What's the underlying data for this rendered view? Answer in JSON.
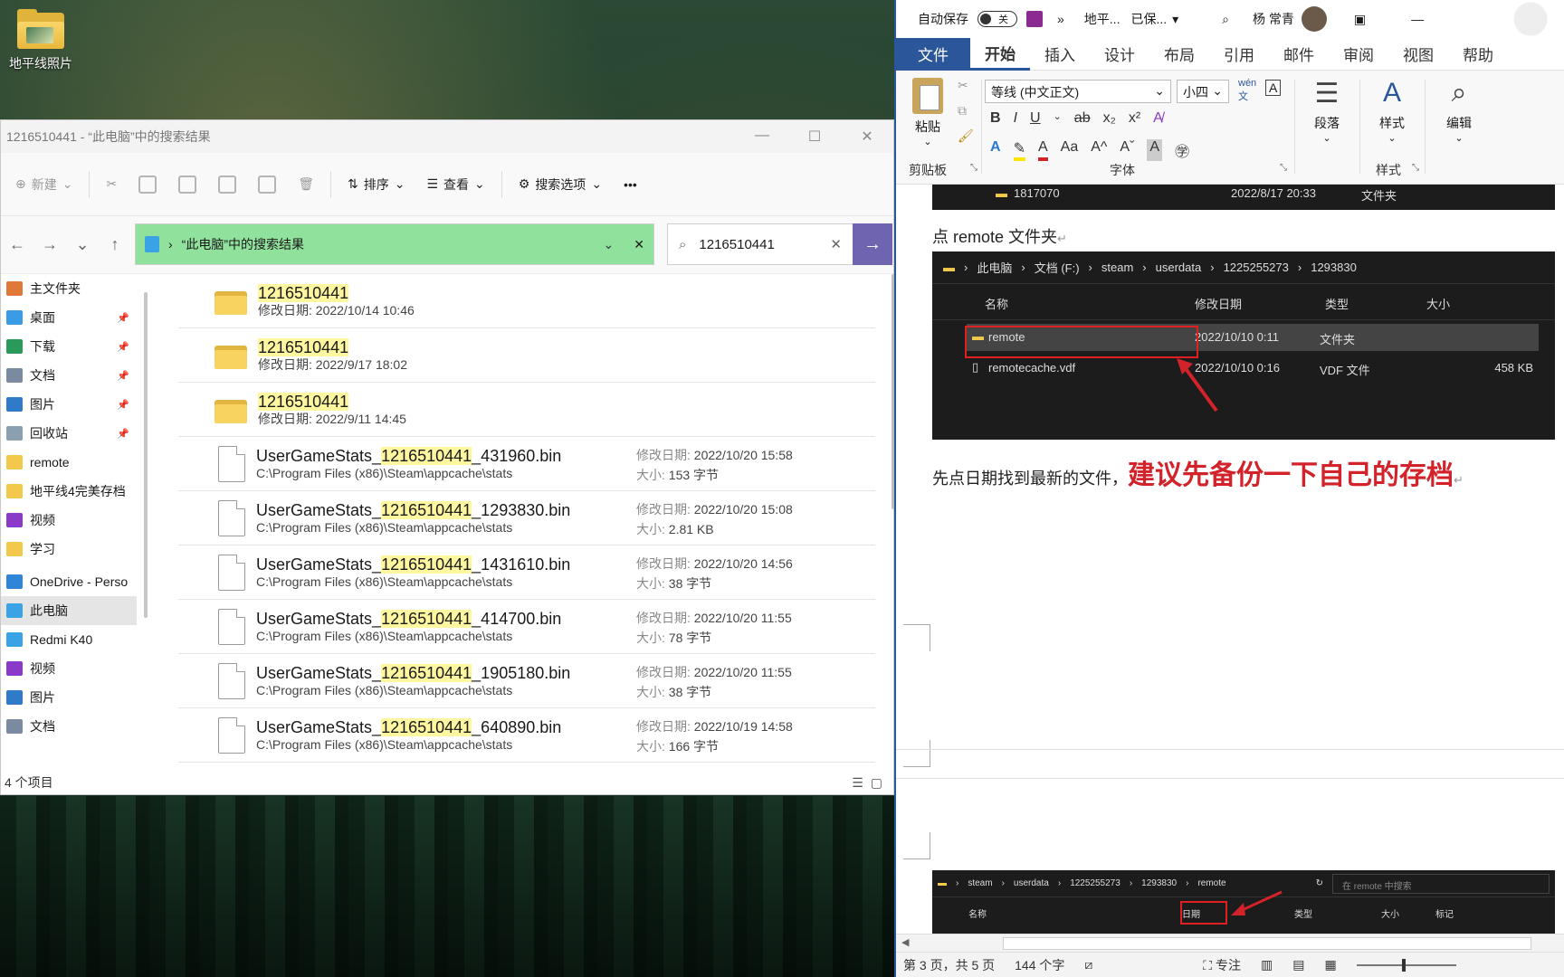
{
  "desktop": {
    "icon_label": "地平线照片"
  },
  "explorer": {
    "title": "1216510441 - “此电脑”中的搜索结果",
    "window_controls": [
      "—",
      "☐",
      "✕"
    ],
    "toolbar": {
      "new": "新建",
      "sort": "排序",
      "view": "查看",
      "search_options": "搜索选项",
      "more": "•••"
    },
    "address": "“此电脑”中的搜索结果",
    "search_value": "1216510441",
    "sidebar": [
      {
        "label": "主文件夹",
        "icon": "home-icon",
        "color": "#e0783a",
        "pinned": false
      },
      {
        "label": "桌面",
        "icon": "desktop-icon",
        "color": "#3a9be6",
        "pinned": true
      },
      {
        "label": "下载",
        "icon": "download-icon",
        "color": "#2a9a5a",
        "pinned": true
      },
      {
        "label": "文档",
        "icon": "document-icon",
        "color": "#7a8aa0",
        "pinned": true
      },
      {
        "label": "图片",
        "icon": "pictures-icon",
        "color": "#2f7ac9",
        "pinned": true
      },
      {
        "label": "回收站",
        "icon": "recycle-bin-icon",
        "color": "#8aa0b0",
        "pinned": true
      },
      {
        "label": "remote",
        "icon": "folder-icon",
        "color": "#f2c94c",
        "pinned": false
      },
      {
        "label": "地平线4完美存档",
        "icon": "folder-icon",
        "color": "#f2c94c",
        "pinned": false
      },
      {
        "label": "视频",
        "icon": "video-icon",
        "color": "#8a3ac9",
        "pinned": false
      },
      {
        "label": "学习",
        "icon": "folder-icon",
        "color": "#f2c94c",
        "pinned": false
      },
      {
        "label": "OneDrive - Perso",
        "icon": "onedrive-icon",
        "color": "#2f86d8",
        "pinned": false
      },
      {
        "label": "此电脑",
        "icon": "this-pc-icon",
        "color": "#3aa3e6",
        "pinned": false
      },
      {
        "label": "Redmi K40",
        "icon": "phone-icon",
        "color": "#3aa3e6",
        "pinned": false
      },
      {
        "label": "视频",
        "icon": "video-icon",
        "color": "#8a3ac9",
        "pinned": false
      },
      {
        "label": "图片",
        "icon": "pictures-icon",
        "color": "#2f7ac9",
        "pinned": false
      },
      {
        "label": "文档",
        "icon": "document-icon",
        "color": "#7a8aa0",
        "pinned": false
      }
    ],
    "folders": [
      {
        "name": "1216510441",
        "date_label": "修改日期:",
        "date": "2022/10/14 10:46"
      },
      {
        "name": "1216510441",
        "date_label": "修改日期:",
        "date": "2022/9/17 18:02"
      },
      {
        "name": "1216510441",
        "date_label": "修改日期:",
        "date": "2022/9/11 14:45"
      }
    ],
    "files": [
      {
        "prefix": "UserGameStats_",
        "match": "1216510441",
        "suffix": "_431960.bin",
        "path": "C:\\Program Files (x86)\\Steam\\appcache\\stats",
        "date_label": "修改日期:",
        "date": "2022/10/20 15:58",
        "size_label": "大小:",
        "size": "153 字节"
      },
      {
        "prefix": "UserGameStats_",
        "match": "1216510441",
        "suffix": "_1293830.bin",
        "path": "C:\\Program Files (x86)\\Steam\\appcache\\stats",
        "date_label": "修改日期:",
        "date": "2022/10/20 15:08",
        "size_label": "大小:",
        "size": "2.81 KB"
      },
      {
        "prefix": "UserGameStats_",
        "match": "1216510441",
        "suffix": "_1431610.bin",
        "path": "C:\\Program Files (x86)\\Steam\\appcache\\stats",
        "date_label": "修改日期:",
        "date": "2022/10/20 14:56",
        "size_label": "大小:",
        "size": "38 字节"
      },
      {
        "prefix": "UserGameStats_",
        "match": "1216510441",
        "suffix": "_414700.bin",
        "path": "C:\\Program Files (x86)\\Steam\\appcache\\stats",
        "date_label": "修改日期:",
        "date": "2022/10/20 11:55",
        "size_label": "大小:",
        "size": "78 字节"
      },
      {
        "prefix": "UserGameStats_",
        "match": "1216510441",
        "suffix": "_1905180.bin",
        "path": "C:\\Program Files (x86)\\Steam\\appcache\\stats",
        "date_label": "修改日期:",
        "date": "2022/10/20 11:55",
        "size_label": "大小:",
        "size": "38 字节"
      },
      {
        "prefix": "UserGameStats_",
        "match": "1216510441",
        "suffix": "_640890.bin",
        "path": "C:\\Program Files (x86)\\Steam\\appcache\\stats",
        "date_label": "修改日期:",
        "date": "2022/10/19 14:58",
        "size_label": "大小:",
        "size": "166 字节"
      }
    ],
    "status": "4 个项目"
  },
  "word": {
    "autosave": "自动保存",
    "autosave_state": "关",
    "doc_title": "地平...",
    "save_state": "已保...",
    "user": "杨 常青",
    "tabs": [
      "文件",
      "开始",
      "插入",
      "设计",
      "布局",
      "引用",
      "邮件",
      "审阅",
      "视图",
      "帮助"
    ],
    "ribbon": {
      "paste": "粘贴",
      "clipboard": "剪贴板",
      "font_name": "等线 (中文正文)",
      "font_size": "小四",
      "font_group": "字体",
      "paragraph": "段落",
      "styles": "样式",
      "styles_group": "样式",
      "editing": "编辑"
    },
    "doc": {
      "top_row": {
        "name": "1817070",
        "date": "2022/8/17 20:33",
        "type": "文件夹"
      },
      "line1": "点 remote 文件夹",
      "shot1": {
        "breadcrumb": [
          "此电脑",
          "文档 (F:)",
          "steam",
          "userdata",
          "1225255273",
          "1293830"
        ],
        "headers": [
          "名称",
          "修改日期",
          "类型",
          "大小"
        ],
        "rows": [
          {
            "name": "remote",
            "date": "2022/10/10 0:11",
            "type": "文件夹",
            "size": ""
          },
          {
            "name": "remotecache.vdf",
            "date": "2022/10/10 0:16",
            "type": "VDF 文件",
            "size": "458 KB"
          }
        ]
      },
      "line2_normal": "先点日期找到最新的文件，",
      "line2_red": "建议先备份一下自己的存档",
      "shot2": {
        "breadcrumb": [
          "steam",
          "userdata",
          "1225255273",
          "1293830",
          "remote"
        ],
        "search_placeholder": "在 remote 中搜索",
        "headers": [
          "名称",
          "日期",
          "类型",
          "大小",
          "标记"
        ]
      }
    },
    "status": {
      "page": "第 3 页，共 5 页",
      "words": "144 个字",
      "focus": "专注"
    },
    "accent": "#2b579a",
    "highlight_red": "#d2222a"
  }
}
